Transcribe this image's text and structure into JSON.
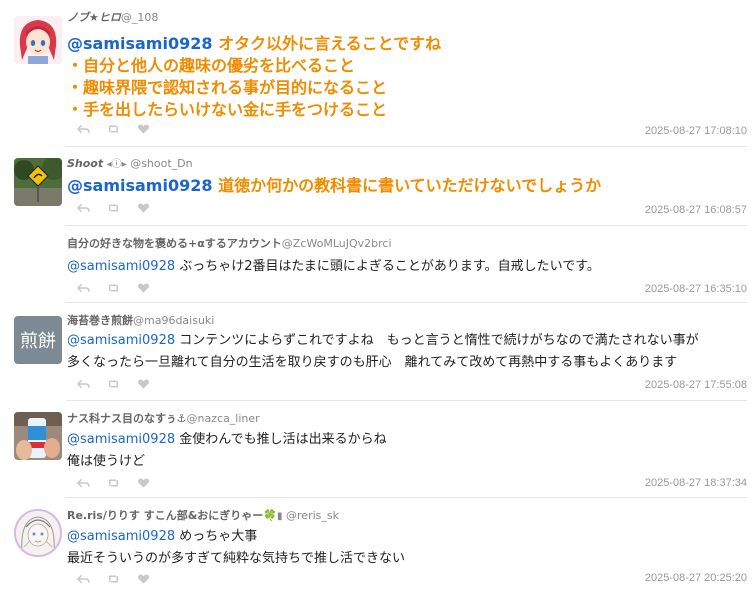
{
  "colors": {
    "mention": "#1a66cc",
    "highlight": "#f08c00",
    "timestamp": "#999999",
    "divider": "#e6e6e6"
  },
  "replies": [
    {
      "name": "ノブ★ヒロ",
      "handle": "@_108",
      "mention": "@samisami0928",
      "lines": [
        "オタク以外に言えることですね",
        "・自分と他人の趣味の優劣を比べること",
        "・趣味界隈で認知される事が目的になること",
        "・手を出したらいけない金に手をつけること"
      ],
      "timestamp": "2025-08-27 17:08:10",
      "avatar": "anime-girl-avatar"
    },
    {
      "name": "Shoot",
      "badge": "◂ⓘ▸",
      "handle": "@shoot_Dn",
      "mention": "@samisami0928",
      "lines": [
        "道徳か何かの教科書に書いていただけないでしょうか"
      ],
      "timestamp": "2025-08-27 16:08:57",
      "avatar": "road-sign-photo-avatar"
    },
    {
      "name": "自分の好きな物を褒める+αするアカウント",
      "handle": "@ZcWoMLuJQv2brci",
      "mention": "@samisami0928",
      "lines": [
        "ぶっちゃけ2番目はたまに頭によぎることがあります。自戒したいです。"
      ],
      "timestamp": "2025-08-27 16:35:10",
      "avatar": "none"
    },
    {
      "name": "海苔巻き煎餅",
      "handle": "@ma96daisuki",
      "mention": "@samisami0928",
      "lines": [
        "コンテンツによらずこれですよね　もっと言うと惰性で続けがちなので満たされない事が",
        "多くなったら一旦離れて自分の生活を取り戻すのも肝心　離れてみて改めて再熱中する事もよくあります"
      ],
      "timestamp": "2025-08-27 17:55:08",
      "avatar_text": "煎餅"
    },
    {
      "name": "ナス科ナス目のなすぅ⚓",
      "handle": "@nazca_liner",
      "mention": "@samisami0928",
      "lines": [
        "金使わんでも推し活は出来るからね",
        "俺は使うけど"
      ],
      "timestamp": "2025-08-27 18:37:34",
      "avatar": "drink-can-photo-avatar"
    },
    {
      "name": "Re.ris/りりす すこん部&おにぎりゃー🍀",
      "badge": "▮",
      "handle": "@reris_sk",
      "mention": "@samisami0928",
      "lines": [
        "めっちゃ大事",
        "最近そういうのが多すぎて純粋な気持ちで推し活できない"
      ],
      "timestamp": "2025-08-27 20:25:20",
      "avatar": "sketch-portrait-avatar"
    }
  ]
}
